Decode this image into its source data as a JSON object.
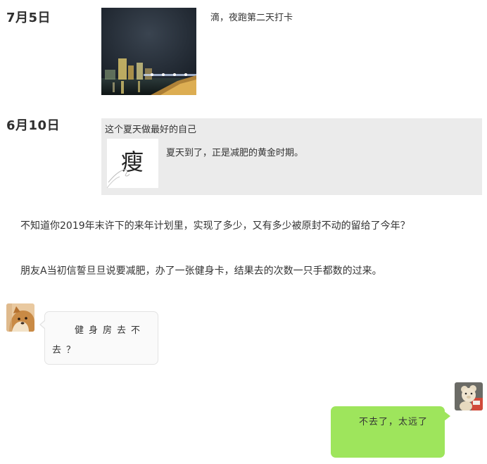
{
  "entries": [
    {
      "date": "7月5日",
      "caption": "滴，夜跑第二天打卡"
    },
    {
      "date": "6月10日",
      "share_card": {
        "title": "这个夏天做最好的自己",
        "thumb_char": "瘦",
        "description": "夏天到了，正是减肥的黄金时期。"
      }
    }
  ],
  "paragraphs": [
    "不知道你2019年末许下的来年计划里，实现了多少，又有多少被原封不动的留给了今年？",
    "朋友A当初信誓旦旦说要减肥，办了一张健身卡，结果去的次数一只手都数的过来。"
  ],
  "chat": [
    {
      "side": "left",
      "avatar": "shiba-dog-avatar",
      "text": "健身房去不去？"
    },
    {
      "side": "right",
      "avatar": "teddy-bear-avatar",
      "text": "不去了，太远了"
    }
  ],
  "colors": {
    "share_card_bg": "#ebebeb",
    "left_bubble_bg": "#fafafa",
    "right_bubble_bg": "#9ee55c",
    "text": "#333333"
  }
}
